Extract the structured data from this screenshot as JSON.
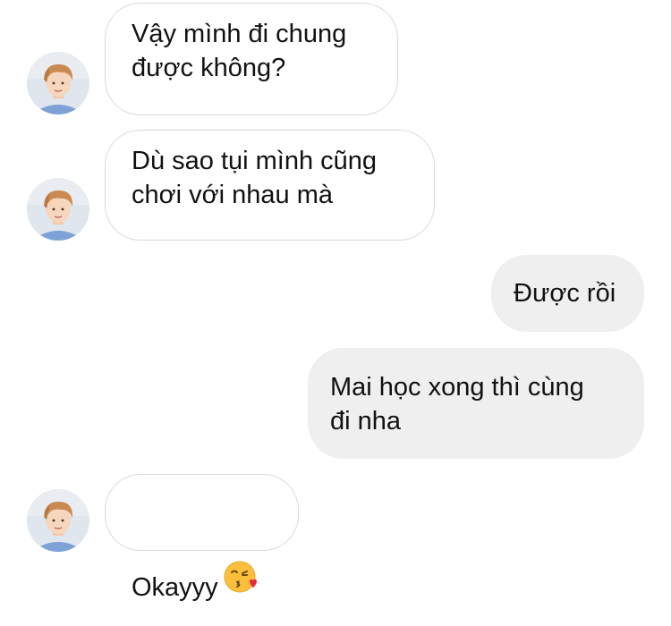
{
  "messages": [
    {
      "sender": "other",
      "text": "Vậy mình đi chung\nđược không?"
    },
    {
      "sender": "other",
      "text": "Dù sao tụi mình cũng\nchơi với nhau mà"
    },
    {
      "sender": "me",
      "text": "Được rồi"
    },
    {
      "sender": "me",
      "text": "Mai học xong thì cùng\nđi nha"
    },
    {
      "sender": "other",
      "text": "Okayyy",
      "emoji": "face-blowing-a-kiss-emoji"
    }
  ],
  "colors": {
    "incoming_bubble": "#ffffff",
    "incoming_border": "#dbdbdb",
    "outgoing_bubble": "#efefef",
    "text": "#111111"
  },
  "icons": {
    "avatar": "contact-avatar-photo",
    "emoji": "face-blowing-a-kiss-emoji"
  }
}
